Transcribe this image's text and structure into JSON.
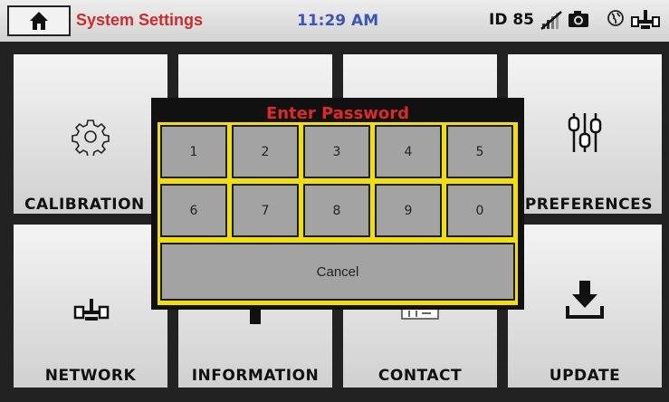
{
  "header": {
    "title": "System Settings",
    "time": "11:29 AM",
    "device_id": "ID 85",
    "icons": [
      "home-icon",
      "wifi-off-icon",
      "camera-icon",
      "globe-icon",
      "network-icon"
    ]
  },
  "tiles": [
    {
      "label": "CALIBRATION",
      "icon": "gear-icon"
    },
    {
      "label": "",
      "icon": ""
    },
    {
      "label": "",
      "icon": ""
    },
    {
      "label": "PREFERENCES",
      "icon": "sliders-icon"
    },
    {
      "label": "NETWORK",
      "icon": "network-icon"
    },
    {
      "label": "INFORMATION",
      "icon": "info-icon"
    },
    {
      "label": "CONTACT",
      "icon": "contact-icon"
    },
    {
      "label": "UPDATE",
      "icon": "download-icon"
    }
  ],
  "dialog": {
    "title": "Enter Password",
    "keys": [
      "1",
      "2",
      "3",
      "4",
      "5",
      "6",
      "7",
      "8",
      "9",
      "0"
    ],
    "cancel_label": "Cancel"
  },
  "colors": {
    "title_red": "#d22a2a",
    "time_blue": "#3c56b8",
    "dialog_border": "#f2e000",
    "key_gray": "#a3a3a3"
  }
}
